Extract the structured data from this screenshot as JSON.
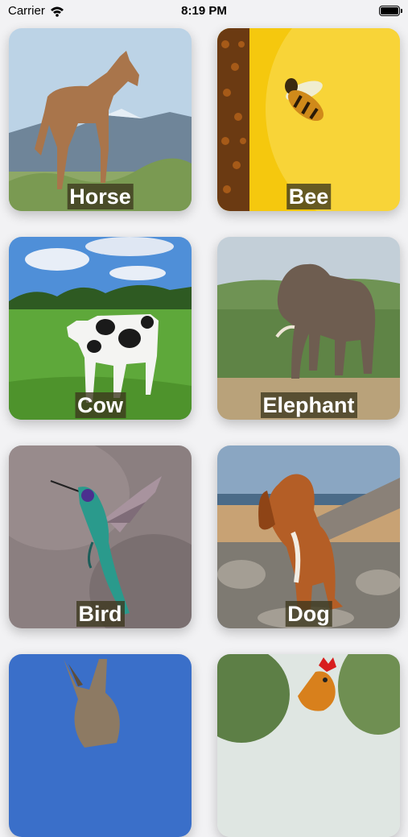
{
  "status_bar": {
    "carrier": "Carrier",
    "time": "8:19 PM"
  },
  "animals": [
    {
      "name": "Horse"
    },
    {
      "name": "Bee"
    },
    {
      "name": "Cow"
    },
    {
      "name": "Elephant"
    },
    {
      "name": "Bird"
    },
    {
      "name": "Dog"
    },
    {
      "name": ""
    },
    {
      "name": ""
    }
  ]
}
